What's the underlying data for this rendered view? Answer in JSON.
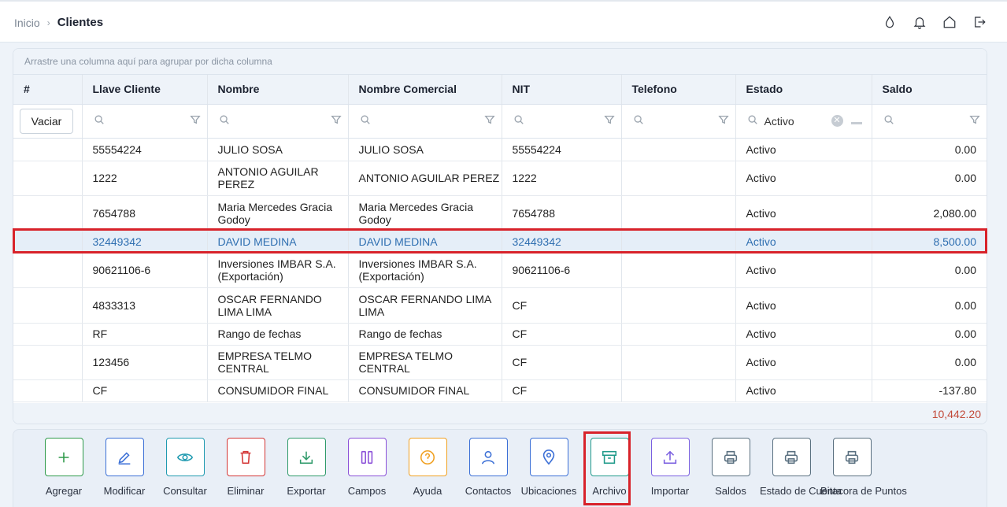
{
  "breadcrumb": {
    "home": "Inicio",
    "separator": "›",
    "current": "Clientes"
  },
  "header_icons": [
    "water-drop-icon",
    "bell-icon",
    "home-icon",
    "logout-icon"
  ],
  "grid": {
    "group_panel_text": "Arrastre una columna aquí para agrupar por dicha columna",
    "columns": [
      "#",
      "Llave Cliente",
      "Nombre",
      "Nombre Comercial",
      "NIT",
      "Telefono",
      "Estado",
      "Saldo"
    ],
    "clear_button": "Vaciar",
    "estado_filter_value": "Activo",
    "rows": [
      {
        "llave": "55554224",
        "nombre": "JULIO SOSA",
        "comercial": "JULIO SOSA",
        "nit": "55554224",
        "telefono": "",
        "estado": "Activo",
        "saldo": "0.00"
      },
      {
        "llave": "1222",
        "nombre": "ANTONIO AGUILAR PEREZ",
        "comercial": "ANTONIO AGUILAR PEREZ",
        "nit": "1222",
        "telefono": "",
        "estado": "Activo",
        "saldo": "0.00"
      },
      {
        "llave": "7654788",
        "nombre": "Maria Mercedes Gracia Godoy",
        "comercial": "Maria Mercedes Gracia Godoy",
        "nit": "7654788",
        "telefono": "",
        "estado": "Activo",
        "saldo": "2,080.00"
      },
      {
        "llave": "32449342",
        "nombre": "DAVID MEDINA",
        "comercial": "DAVID MEDINA",
        "nit": "32449342",
        "telefono": "",
        "estado": "Activo",
        "saldo": "8,500.00",
        "selected": true
      },
      {
        "llave": "90621106-6",
        "nombre": "Inversiones IMBAR S.A. (Exportación)",
        "comercial": "Inversiones IMBAR S.A. (Exportación)",
        "nit": "90621106-6",
        "telefono": "",
        "estado": "Activo",
        "saldo": "0.00"
      },
      {
        "llave": "4833313",
        "nombre": "OSCAR FERNANDO LIMA LIMA",
        "comercial": "OSCAR FERNANDO LIMA LIMA",
        "nit": "CF",
        "telefono": "",
        "estado": "Activo",
        "saldo": "0.00"
      },
      {
        "llave": "RF",
        "nombre": "Rango de fechas",
        "comercial": "Rango de fechas",
        "nit": "CF",
        "telefono": "",
        "estado": "Activo",
        "saldo": "0.00"
      },
      {
        "llave": "123456",
        "nombre": "EMPRESA TELMO CENTRAL",
        "comercial": "EMPRESA TELMO CENTRAL",
        "nit": "CF",
        "telefono": "",
        "estado": "Activo",
        "saldo": "0.00"
      },
      {
        "llave": "CF",
        "nombre": "CONSUMIDOR FINAL",
        "comercial": "CONSUMIDOR FINAL",
        "nit": "CF",
        "telefono": "",
        "estado": "Activo",
        "saldo": "-137.80"
      }
    ],
    "total_saldo": "10,442.20"
  },
  "toolbar": {
    "buttons": [
      {
        "label": "Agregar",
        "icon": "plus-icon",
        "color": "#2e9a4a"
      },
      {
        "label": "Modificar",
        "icon": "pencil-icon",
        "color": "#3b6fd6"
      },
      {
        "label": "Consultar",
        "icon": "eye-icon",
        "color": "#1f9ab0"
      },
      {
        "label": "Eliminar",
        "icon": "trash-icon",
        "color": "#d33535"
      },
      {
        "label": "Exportar",
        "icon": "download-icon",
        "color": "#2e9a6a"
      },
      {
        "label": "Campos",
        "icon": "columns-icon",
        "color": "#8a4fd8"
      },
      {
        "label": "Ayuda",
        "icon": "help-circle-icon",
        "color": "#f0a020"
      },
      {
        "label": "Contactos",
        "icon": "user-icon",
        "color": "#3b6fd6"
      },
      {
        "label": "Ubicaciones",
        "icon": "map-pin-icon",
        "color": "#3b6fd6"
      },
      {
        "label": "Archivo",
        "icon": "archive-icon",
        "color": "#1f9a8a"
      },
      {
        "label": "Importar",
        "icon": "upload-icon",
        "color": "#7a5fe0"
      },
      {
        "label": "Saldos",
        "icon": "printer-icon",
        "color": "#5a7080"
      },
      {
        "label": "Estado de Cuenta",
        "icon": "printer-icon",
        "color": "#5a7080"
      },
      {
        "label": "Bitacora de Puntos",
        "icon": "printer-icon",
        "color": "#5a7080"
      }
    ]
  }
}
